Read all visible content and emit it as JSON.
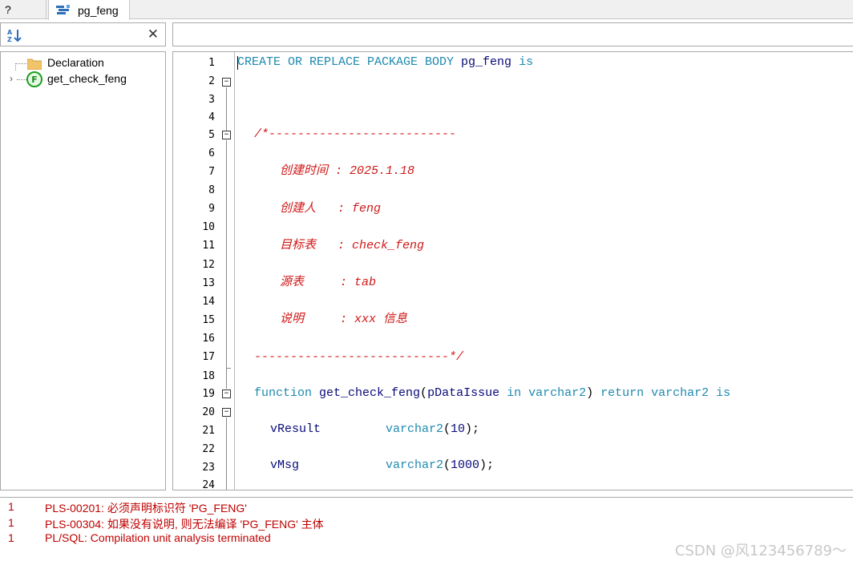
{
  "tabs": [
    {
      "label": "?"
    },
    {
      "label": "pg_feng"
    }
  ],
  "tree": {
    "items": [
      {
        "label": "Declaration",
        "icon": "folder-icon"
      },
      {
        "label": "get_check_feng",
        "icon": "function-icon",
        "icon_letter": "F"
      }
    ]
  },
  "editor": {
    "line_numbers": [
      "1",
      "2",
      "3",
      "4",
      "5",
      "6",
      "7",
      "8",
      "9",
      "10",
      "11",
      "12",
      "13",
      "14",
      "15",
      "16",
      "17",
      "18",
      "19",
      "20",
      "21",
      "22",
      "23",
      "24"
    ],
    "lines": {
      "l1": {
        "kw1": "CREATE OR REPLACE PACKAGE BODY ",
        "id1": "pg_feng",
        "kw2": " is"
      },
      "l5": "/*--------------------------",
      "l7": "创建时间 : 2025.1.18",
      "l9": "创建人   : feng",
      "l11": "目标表   : check_feng",
      "l13": "源表     : tab",
      "l15": "说明     : xxx 信息",
      "l17": "---------------------------*/",
      "l19": {
        "kw1": "function ",
        "id1": "get_check_feng",
        "p1": "(",
        "id2": "pDataIssue",
        "kw2": " in varchar2",
        "p2": ") ",
        "kw3": "return varchar2 is"
      },
      "l21": {
        "id1": "vResult",
        "kw1": "varchar2",
        "p1": "(",
        "num": "10",
        "p2": ");"
      },
      "l23": {
        "id1": "vMsg",
        "kw1": "varchar2",
        "p1": "(",
        "num": "1000",
        "p2": ");"
      }
    }
  },
  "messages": [
    {
      "num": "1",
      "text": "PLS-00201: 必须声明标识符 'PG_FENG'"
    },
    {
      "num": "1",
      "text": "PLS-00304: 如果没有说明, 则无法编译 'PG_FENG' 主体"
    },
    {
      "num": "1",
      "text": "PL/SQL: Compilation unit analysis terminated"
    }
  ],
  "watermark": "CSDN @风123456789～",
  "colors": {
    "keyword": "#1f8ab0",
    "identifier": "#0a0a7a",
    "comment": "#d01818",
    "error": "#c00000"
  }
}
